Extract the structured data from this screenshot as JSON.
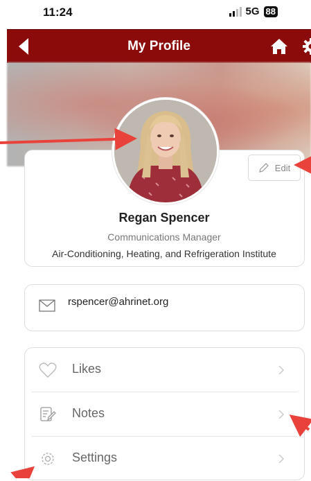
{
  "status_bar": {
    "time": "11:24",
    "network": "5G",
    "battery": "88"
  },
  "header": {
    "title": "My Profile",
    "icons": [
      "back-icon",
      "home-icon",
      "gear-icon"
    ]
  },
  "profile": {
    "edit_label": "Edit",
    "name": "Regan Spencer",
    "job_title": "Communications Manager",
    "company": "Air-Conditioning, Heating, and Refrigeration Institute"
  },
  "contact": {
    "email": "rspencer@ahrinet.org"
  },
  "menu": {
    "items": [
      {
        "label": "Likes",
        "icon": "heart-icon"
      },
      {
        "label": "Notes",
        "icon": "notes-icon"
      },
      {
        "label": "Settings",
        "icon": "gear-icon"
      }
    ]
  },
  "colors": {
    "brand": "#8b0b0b",
    "annotation": "#e8423b"
  }
}
